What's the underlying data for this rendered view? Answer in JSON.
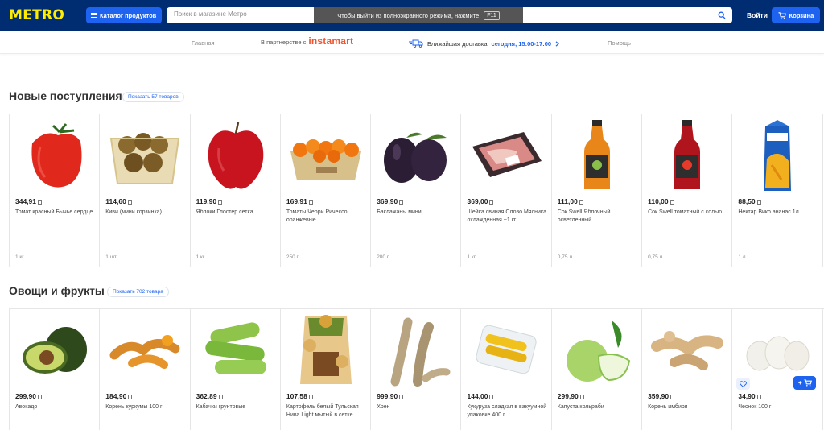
{
  "header": {
    "logo": "METRO",
    "catalog_label": "Каталог продуктов",
    "search_placeholder": "Поиск в магазине Метро",
    "fullscreen_notice": "Чтобы выйти из полноэкранного режима, нажмите",
    "fullscreen_key": "F11",
    "login_label": "Войти",
    "cart_label": "Корзина"
  },
  "subnav": {
    "home": "Главная",
    "partner_prefix": "В партнерстве с",
    "partner_brand": "instamart",
    "delivery_label": "Ближайшая доставка",
    "delivery_time": "сегодня, 15:00-17:00",
    "help": "Помощь"
  },
  "sections": [
    {
      "title": "Новые поступления",
      "show_all": "Показать 57 товаров",
      "products": [
        {
          "price": "344,91",
          "name": "Томат красный Бычье сердце",
          "unit": "1 кг",
          "icon": "tomato-image"
        },
        {
          "price": "114,60",
          "name": "Киви (мини корзинка)",
          "unit": "1 шт",
          "icon": "kiwi-basket-image"
        },
        {
          "price": "119,90",
          "name": "Яблоки Глостер сетка",
          "unit": "1 кг",
          "icon": "apple-image"
        },
        {
          "price": "169,91",
          "name": "Томаты Черри Ричессо оранжевые",
          "unit": "250 г",
          "icon": "cherry-tomatoes-image"
        },
        {
          "price": "369,90",
          "name": "Баклажаны мини",
          "unit": "200 г",
          "icon": "eggplant-image"
        },
        {
          "price": "369,00",
          "name": "Шейка свиная Слово Мясника охлажденная ~1 кг",
          "unit": "1 кг",
          "icon": "pork-tray-image"
        },
        {
          "price": "111,00",
          "name": "Сок Swell Яблочный осветленный",
          "unit": "0,75 л",
          "icon": "apple-juice-bottle-image"
        },
        {
          "price": "110,00",
          "name": "Сок Swell томатный с солью",
          "unit": "0,75 л",
          "icon": "tomato-juice-bottle-image"
        },
        {
          "price": "88,50",
          "name": "Нектар Вико ананас 1л",
          "unit": "1 л",
          "icon": "juice-carton-image"
        }
      ]
    },
    {
      "title": "Овощи и фрукты",
      "show_all": "Показать 702 товара",
      "products": [
        {
          "price": "299,90",
          "name": "Авокадо",
          "icon": "avocado-image"
        },
        {
          "price": "184,90",
          "name": "Корень куркумы 100 г",
          "icon": "turmeric-image"
        },
        {
          "price": "362,89",
          "name": "Кабачки грунтовые",
          "icon": "zucchini-image"
        },
        {
          "price": "107,58",
          "name": "Картофель белый Тульская Нива Light мытый в сетке",
          "icon": "potato-bag-image"
        },
        {
          "price": "999,90",
          "name": "Хрен",
          "icon": "horseradish-image"
        },
        {
          "price": "144,00",
          "name": "Кукуруза сладкая в вакуумной упаковке 400 г",
          "icon": "corn-image"
        },
        {
          "price": "299,90",
          "name": "Капуста кольраби",
          "icon": "kohlrabi-image"
        },
        {
          "price": "359,90",
          "name": "Корень имбиря",
          "icon": "ginger-image"
        },
        {
          "price": "34,90",
          "name": "Чеснок 100 г",
          "icon": "garlic-image"
        }
      ]
    }
  ],
  "colors": {
    "header_bg": "#002d72",
    "logo": "#ffed00",
    "accent": "#1e63f0",
    "instamart": "#f0532f"
  }
}
